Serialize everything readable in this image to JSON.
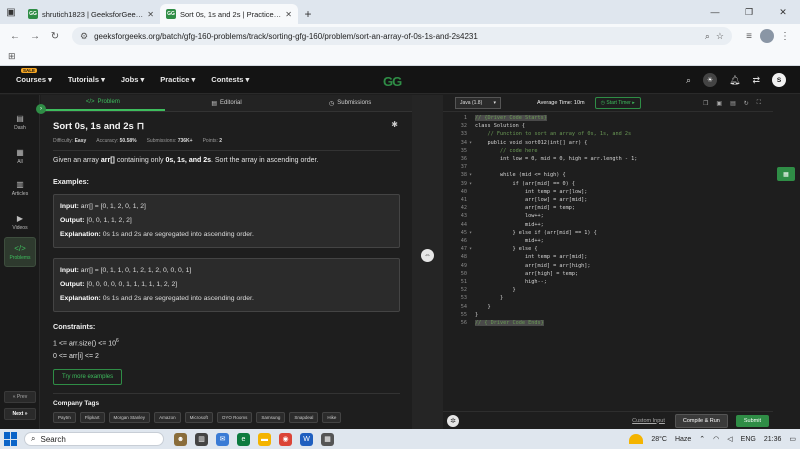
{
  "browser": {
    "tabs": [
      {
        "title": "shrutich1823 | GeeksforGeeks P",
        "active": false
      },
      {
        "title": "Sort 0s, 1s and 2s | Practice | Ge",
        "active": true
      }
    ],
    "url": "geeksforgeeks.org/batch/gfg-160-problems/track/sorting-gfg-160/problem/sort-an-array-of-0s-1s-and-2s4231"
  },
  "header": {
    "menu": [
      {
        "label": "Courses",
        "badge": "SALE"
      },
      {
        "label": "Tutorials"
      },
      {
        "label": "Jobs"
      },
      {
        "label": "Practice"
      },
      {
        "label": "Contests"
      }
    ],
    "logo": "GG",
    "user_initial": "S"
  },
  "rail": {
    "items": [
      {
        "label": "Dash",
        "icon": "dashboard-icon"
      },
      {
        "label": "All",
        "icon": "grid-icon"
      },
      {
        "label": "Articles",
        "icon": "article-icon"
      },
      {
        "label": "Videos",
        "icon": "video-icon"
      },
      {
        "label": "Problems",
        "icon": "code-icon"
      }
    ],
    "prev": "« Prev",
    "next": "Next »"
  },
  "problem": {
    "tabs": [
      "Problem",
      "Editorial",
      "Submissions"
    ],
    "title": "Sort 0s, 1s and 2s",
    "meta": {
      "difficulty_label": "Difficulty:",
      "difficulty": "Easy",
      "accuracy_label": "Accuracy:",
      "accuracy": "50.58%",
      "submissions_label": "Submissions:",
      "submissions": "736K+",
      "points_label": "Points:",
      "points": "2"
    },
    "desc_pre": "Given an array ",
    "desc_arr": "arr[]",
    "desc_mid": " containing only ",
    "desc_vals": "0s, 1s, and 2s",
    "desc_post": ". Sort the array in ascending order.",
    "examples_heading": "Examples:",
    "examples": [
      {
        "input": "arr[] = [0, 1, 2, 0, 1, 2]",
        "output": "[0, 0, 1, 1, 2, 2]",
        "explanation": "0s 1s and 2s are segregated into ascending order."
      },
      {
        "input": "arr[] = [0, 1, 1, 0, 1, 2, 1, 2, 0, 0, 0, 1]",
        "output": "[0, 0, 0, 0, 0, 1, 1, 1, 1, 1, 2, 2]",
        "explanation": "0s 1s and 2s are segregated into ascending order."
      }
    ],
    "input_label": "Input:",
    "output_label": "Output:",
    "explanation_label": "Explanation:",
    "constraints_heading": "Constraints:",
    "constraint1_pre": "1 <= arr.size() <= 10",
    "constraint1_sup": "6",
    "constraint2": "0 <= arr[i] <= 2",
    "try_more": "Try more examples",
    "company_tags_heading": "Company Tags",
    "company_tags": [
      "Paytm",
      "Flipkart",
      "Morgan Stanley",
      "Amazon",
      "Microsoft",
      "OYO Rooms",
      "Samsung",
      "Snapdeal",
      "Hike"
    ]
  },
  "editor": {
    "language": "Java (1.8)",
    "avg_time": "Average Time: 10m",
    "start_timer": "Start Timer",
    "lines": [
      {
        "n": "1",
        "f": "",
        "t": "// {Driver Code Starts}",
        "hl": true
      },
      {
        "n": "32",
        "f": "",
        "t": "class Solution {"
      },
      {
        "n": "33",
        "f": "",
        "t": "    // Function to sort an array of 0s, 1s, and 2s",
        "cm": true
      },
      {
        "n": "34",
        "f": "▾",
        "t": "    public void sort012(int[] arr) {"
      },
      {
        "n": "35",
        "f": "",
        "t": "        // code here",
        "cm": true
      },
      {
        "n": "36",
        "f": "",
        "t": "        int low = 0, mid = 0, high = arr.length - 1;"
      },
      {
        "n": "37",
        "f": "",
        "t": ""
      },
      {
        "n": "38",
        "f": "▾",
        "t": "        while (mid <= high) {"
      },
      {
        "n": "39",
        "f": "▾",
        "t": "            if (arr[mid] == 0) {"
      },
      {
        "n": "40",
        "f": "",
        "t": "                int temp = arr[low];"
      },
      {
        "n": "41",
        "f": "",
        "t": "                arr[low] = arr[mid];"
      },
      {
        "n": "42",
        "f": "",
        "t": "                arr[mid] = temp;"
      },
      {
        "n": "43",
        "f": "",
        "t": "                low++;"
      },
      {
        "n": "44",
        "f": "",
        "t": "                mid++;"
      },
      {
        "n": "45",
        "f": "▾",
        "t": "            } else if (arr[mid] == 1) {"
      },
      {
        "n": "46",
        "f": "",
        "t": "                mid++;"
      },
      {
        "n": "47",
        "f": "▾",
        "t": "            } else {"
      },
      {
        "n": "48",
        "f": "",
        "t": "                int temp = arr[mid];"
      },
      {
        "n": "49",
        "f": "",
        "t": "                arr[mid] = arr[high];"
      },
      {
        "n": "50",
        "f": "",
        "t": "                arr[high] = temp;"
      },
      {
        "n": "51",
        "f": "",
        "t": "                high--;"
      },
      {
        "n": "52",
        "f": "",
        "t": "            }"
      },
      {
        "n": "53",
        "f": "",
        "t": "        }"
      },
      {
        "n": "54",
        "f": "",
        "t": "    }"
      },
      {
        "n": "55",
        "f": "",
        "t": "}"
      },
      {
        "n": "56",
        "f": "",
        "t": "// { Driver Code Ends}",
        "hl": true
      }
    ],
    "custom_input": "Custom Input",
    "compile_run": "Compile & Run",
    "submit": "Submit"
  },
  "taskbar": {
    "search": "Search",
    "temperature": "28°C",
    "weather": "Haze",
    "language": "ENG",
    "time": "21:36"
  },
  "colors": {
    "accent": "#2f8d46",
    "accent_text": "#3ebd5d",
    "bg": "#1e1e1e"
  }
}
